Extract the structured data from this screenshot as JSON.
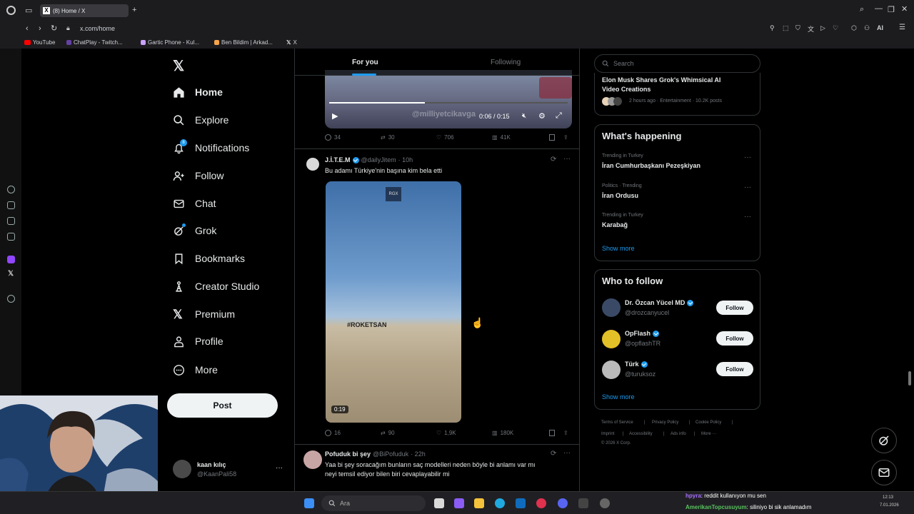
{
  "browser": {
    "tab_title": "(8) Home / X",
    "url": "x.com/home",
    "bookmarks": [
      "YouTube",
      "ChatPlay - Twitch...",
      "Gartic Phone - Kul...",
      "Ben Bildim | Arkad...",
      "X"
    ],
    "ai_label": "AI"
  },
  "sidebar": {
    "logo": "X",
    "items": [
      {
        "label": "Home",
        "icon": "home-icon"
      },
      {
        "label": "Explore",
        "icon": "search-icon"
      },
      {
        "label": "Notifications",
        "icon": "bell-icon",
        "badge": "8"
      },
      {
        "label": "Follow",
        "icon": "add-person-icon"
      },
      {
        "label": "Chat",
        "icon": "mail-icon"
      },
      {
        "label": "Grok",
        "icon": "grok-icon"
      },
      {
        "label": "Bookmarks",
        "icon": "bookmark-icon"
      },
      {
        "label": "Creator Studio",
        "icon": "creator-icon"
      },
      {
        "label": "Premium",
        "icon": "x-icon"
      },
      {
        "label": "Profile",
        "icon": "person-icon"
      },
      {
        "label": "More",
        "icon": "more-circle-icon"
      }
    ],
    "post_label": "Post",
    "account": {
      "name": "kaan kılıç",
      "handle": "@KaanPali58",
      "more": "···"
    }
  },
  "feed": {
    "tabs": [
      "For you",
      "Following"
    ],
    "video_time": "0:06 / 0:15",
    "video_watermark": "@milliyetcikavga",
    "post1_actions": {
      "replies": "34",
      "reposts": "30",
      "likes": "706",
      "views": "41K"
    },
    "post2": {
      "name": "J.İ.T.E.M",
      "handle": "@dailyJitem",
      "time": "· 10h",
      "text": "Bu adamı Türkiye'nin başına kim bela etti",
      "video_badge": "RGX",
      "video_caption": "#ROKETSAN",
      "duration": "0:19",
      "actions": {
        "replies": "16",
        "reposts": "90",
        "likes": "1,9K",
        "views": "180K"
      }
    },
    "post3": {
      "name": "Pofuduk bi şey",
      "handle": "@BiPofuduk",
      "time": "· 22h",
      "text_line1": "Yaa bi şey soracağım bunların saç modelleri neden böyle bi anlamı var mı",
      "text_line2": "neyi temsil ediyor bilen biri cevaplayabilir mi"
    }
  },
  "right": {
    "search_placeholder": "Search",
    "news": {
      "title_line1": "Elon Musk Shares Grok's Whimsical AI",
      "title_line2": "Video Creations",
      "meta": "2 hours ago · Entertainment · 10.2K posts"
    },
    "happening_title": "What's happening",
    "trends": [
      {
        "context": "Trending in Turkey",
        "name": "İran Cumhurbaşkanı Pezeşkiyan"
      },
      {
        "context": "Politics · Trending",
        "name": "İran Ordusu"
      },
      {
        "context": "Trending in Turkey",
        "name": "Karabağ"
      }
    ],
    "show_more": "Show more",
    "who_title": "Who to follow",
    "who": [
      {
        "name": "Dr. Özcan Yücel MD",
        "handle": "@drozcanyucel",
        "button": "Follow"
      },
      {
        "name": "OpFlash",
        "handle": "@opflashTR",
        "button": "Follow"
      },
      {
        "name": "Türk",
        "handle": "@turuksoz",
        "button": "Follow"
      }
    ],
    "footer": {
      "links1": [
        "Terms of Service",
        "|",
        "Privacy Policy",
        "|",
        "Cookie Policy",
        "|"
      ],
      "links2": [
        "Imprint",
        "|",
        "Accessibility",
        "|",
        "Ads info",
        "|",
        "More ···"
      ],
      "copyright": "© 2026 X Corp."
    }
  },
  "taskbar": {
    "search_placeholder": "Ara",
    "chat": [
      {
        "user": "hpyra",
        "msg": ": reddit kullanıyon mu sen"
      },
      {
        "user": "AmerikanTopcusuyum",
        "msg": ": siliniyo bi sik anlamadım"
      }
    ],
    "clock_time": "12:13",
    "clock_date": "7.01.2026"
  },
  "colors": {
    "accent": "#1d9bf0",
    "border": "#2f3336",
    "muted": "#71767b",
    "bg": "#000000"
  }
}
